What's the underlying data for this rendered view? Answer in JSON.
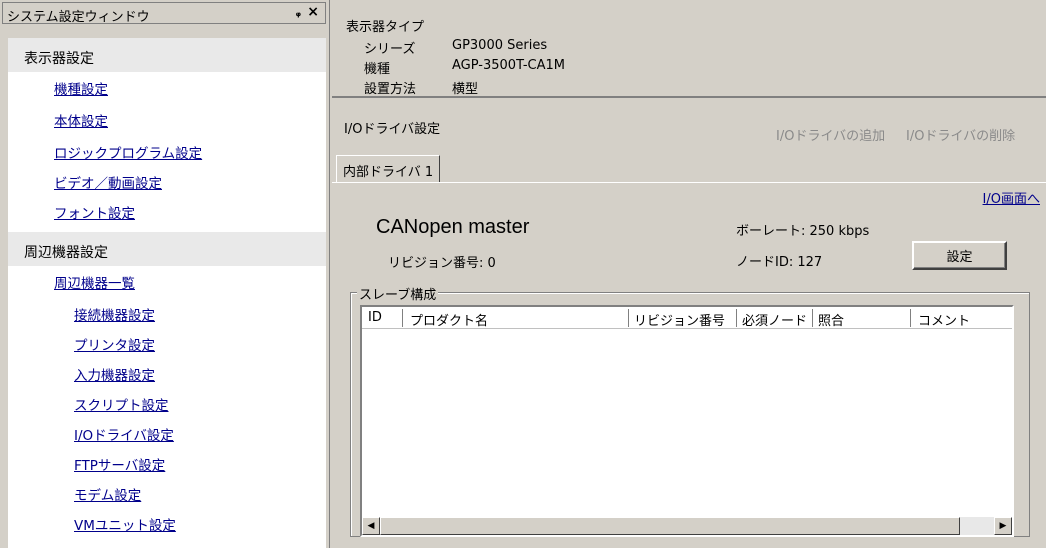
{
  "panel": {
    "title": "システム設定ウィンドウ",
    "pin_glyph": "ᵩ",
    "close_glyph": "×"
  },
  "display_settings": {
    "header": "表示器設定",
    "items": [
      "機種設定",
      "本体設定",
      "ロジックプログラム設定",
      "ビデオ／動画設定",
      "フォント設定"
    ]
  },
  "peripheral_settings": {
    "header": "周辺機器設定",
    "list_link": "周辺機器一覧",
    "items": [
      "接続機器設定",
      "プリンタ設定",
      "入力機器設定",
      "スクリプト設定",
      "I/Oドライバ設定",
      "FTPサーバ設定",
      "モデム設定",
      "VMユニット設定"
    ]
  },
  "display_info": {
    "type_label": "表示器タイプ",
    "series_label": "シリーズ",
    "series_value": "GP3000 Series",
    "model_label": "機種",
    "model_value": "AGP-3500T-CA1M",
    "install_label": "設置方法",
    "install_value": "横型"
  },
  "io_driver": {
    "title": "I/Oドライバ設定",
    "add_label": "I/Oドライバの追加",
    "delete_label": "I/Oドライバの削除",
    "tab_label": "内部ドライバ 1",
    "io_screen_link": "I/O画面へ",
    "device_name": "CANopen master",
    "revision_text": "リビジョン番号: 0",
    "baudrate_text": "ボーレート: 250 kbps",
    "nodeid_text": "ノードID: 127",
    "settings_button": "設定",
    "slave_group_label": "スレーブ構成",
    "columns": [
      "ID",
      "プロダクト名",
      "リビジョン番号",
      "必須ノード",
      "照合",
      "コメント"
    ]
  }
}
